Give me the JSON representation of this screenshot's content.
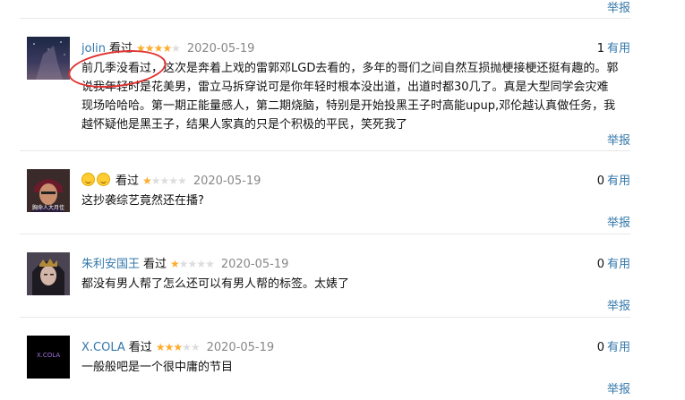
{
  "report_label": "举报",
  "useful_label": "有用",
  "colors": {
    "link": "#3377aa",
    "star": "#ffac2d",
    "annotation": "#e03030"
  },
  "comments": [
    {
      "user": "jolin",
      "tag": "看过",
      "rating": 4,
      "date": "2020-05-19",
      "votes": "1",
      "text": "前几季没看过，这次是奔着上戏的雷郭邓LGD去看的，多年的哥们之间自然互损抛梗接梗还挺有趣的。郭说我年轻时是花美男，雷立马拆穿说可是你年轻时根本没出道，出道时都30几了。真是大型同学会灾难现场哈哈哈。第一期正能量感人，第二期烧脑，特别是开始投黑王子时高能upup,邓伦越认真做任务，我越怀疑他是黑王子，结果人家真的只是个积极的平民，笑死我了"
    },
    {
      "user": "",
      "tag": "看过",
      "rating": 1,
      "date": "2020-05-19",
      "votes": "0",
      "avatar_text": "胸命人大月佳",
      "text": "这抄袭综艺竟然还在播?"
    },
    {
      "user": "朱利安国王",
      "tag": "看过",
      "rating": 1,
      "date": "2020-05-19",
      "votes": "0",
      "text": "都没有男人帮了怎么还可以有男人帮的标签。太婊了"
    },
    {
      "user": "X.COLA",
      "tag": "看过",
      "rating": 3,
      "date": "2020-05-19",
      "votes": "0",
      "avatar_text": "X.COLA",
      "text": "一般般吧是一个很中庸的节目"
    }
  ]
}
